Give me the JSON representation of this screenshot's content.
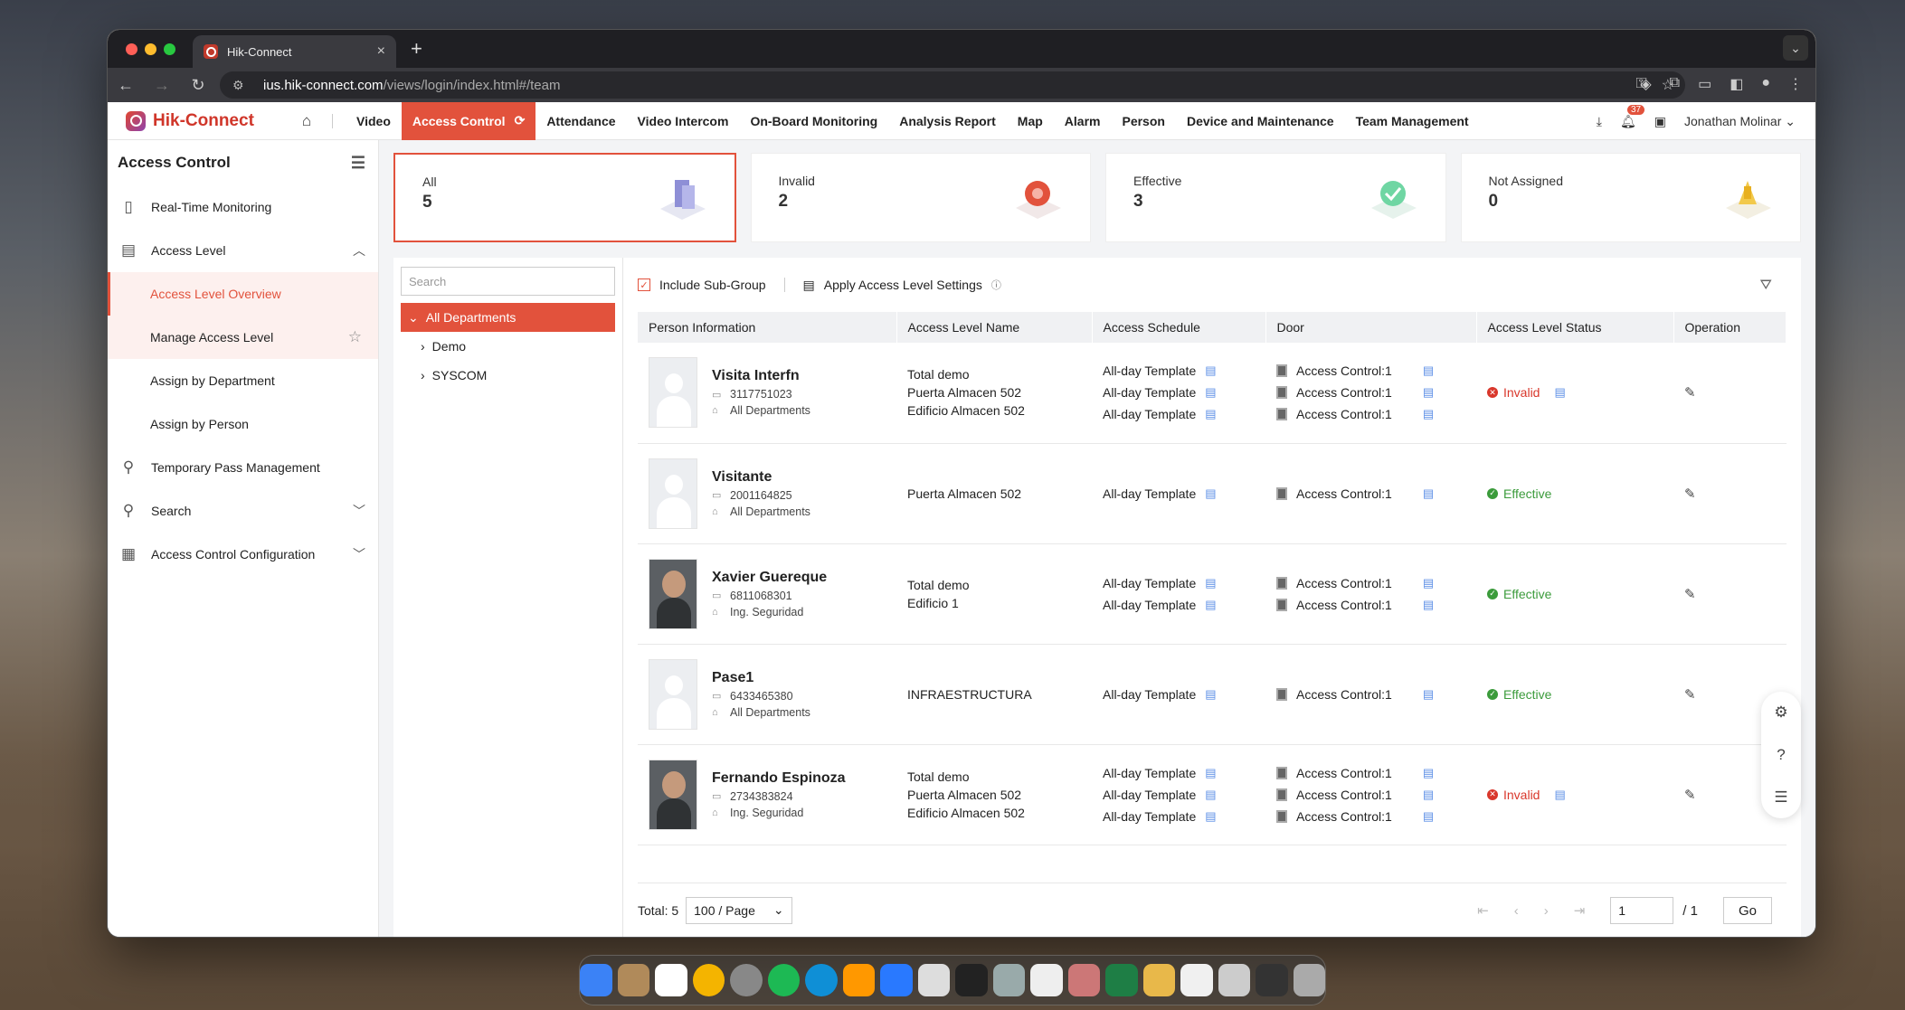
{
  "browser": {
    "tab_title": "Hik-Connect",
    "url_host": "ius.hik-connect.com",
    "url_path": "/views/login/index.html#/team"
  },
  "header": {
    "logo": "Hik-Connect",
    "nav": [
      "Video",
      "Access Control",
      "Attendance",
      "Video Intercom",
      "On-Board Monitoring",
      "Analysis Report",
      "Map",
      "Alarm",
      "Person",
      "Device and Maintenance",
      "Team Management"
    ],
    "active_nav": "Access Control",
    "notification_count": "37",
    "user": "Jonathan Molinar"
  },
  "sidebar": {
    "title": "Access Control",
    "items": [
      {
        "label": "Real-Time Monitoring",
        "icon": "monitor-icon"
      },
      {
        "label": "Access Level",
        "icon": "access-level-icon"
      },
      {
        "label": "Temporary Pass Management",
        "icon": "pass-icon"
      },
      {
        "label": "Search",
        "icon": "search-icon"
      },
      {
        "label": "Access Control Configuration",
        "icon": "config-icon"
      }
    ],
    "subitems": [
      "Access Level Overview",
      "Manage Access Level",
      "Assign by Department",
      "Assign by Person"
    ]
  },
  "cards": [
    {
      "label": "All",
      "value": "5"
    },
    {
      "label": "Invalid",
      "value": "2"
    },
    {
      "label": "Effective",
      "value": "3"
    },
    {
      "label": "Not Assigned",
      "value": "0"
    }
  ],
  "tree": {
    "search_placeholder": "Search",
    "root": "All Departments",
    "children": [
      "Demo",
      "SYSCOM"
    ]
  },
  "toolbar": {
    "include_subgroup": "Include Sub-Group",
    "apply_settings": "Apply Access Level Settings"
  },
  "table": {
    "columns": [
      "Person Information",
      "Access Level Name",
      "Access Schedule",
      "Door",
      "Access Level Status",
      "Operation"
    ],
    "rows": [
      {
        "name": "Visita Interfn",
        "id": "3117751023",
        "dept": "All Departments",
        "levels": [
          "Total demo",
          "Puerta Almacen 502",
          "Edificio Almacen 502"
        ],
        "schedules": [
          "All-day Template",
          "All-day Template",
          "All-day Template"
        ],
        "doors": [
          "Access Control:1",
          "Access Control:1",
          "Access Control:1"
        ],
        "status": "Invalid"
      },
      {
        "name": "Visitante",
        "id": "2001164825",
        "dept": "All Departments",
        "levels": [
          "Puerta Almacen 502"
        ],
        "schedules": [
          "All-day Template"
        ],
        "doors": [
          "Access Control:1"
        ],
        "status": "Effective"
      },
      {
        "name": "Xavier Guereque",
        "id": "6811068301",
        "dept": "Ing. Seguridad",
        "levels": [
          "Total demo",
          "Edificio 1"
        ],
        "schedules": [
          "All-day Template",
          "All-day Template"
        ],
        "doors": [
          "Access Control:1",
          "Access Control:1"
        ],
        "status": "Effective"
      },
      {
        "name": "Pase1",
        "id": "6433465380",
        "dept": "All Departments",
        "levels": [
          "INFRAESTRUCTURA"
        ],
        "schedules": [
          "All-day Template"
        ],
        "doors": [
          "Access Control:1"
        ],
        "status": "Effective"
      },
      {
        "name": "Fernando Espinoza",
        "id": "2734383824",
        "dept": "Ing. Seguridad",
        "levels": [
          "Total demo",
          "Puerta Almacen 502",
          "Edificio Almacen 502"
        ],
        "schedules": [
          "All-day Template",
          "All-day Template",
          "All-day Template"
        ],
        "doors": [
          "Access Control:1",
          "Access Control:1",
          "Access Control:1"
        ],
        "status": "Invalid"
      }
    ]
  },
  "footer": {
    "total": "Total: 5",
    "per_page": "100 / Page",
    "page_input": "1",
    "page_total": "/ 1",
    "go": "Go"
  },
  "colors": {
    "accent": "#e2523c",
    "invalid": "#d9372b",
    "effective": "#3b9b3b"
  }
}
